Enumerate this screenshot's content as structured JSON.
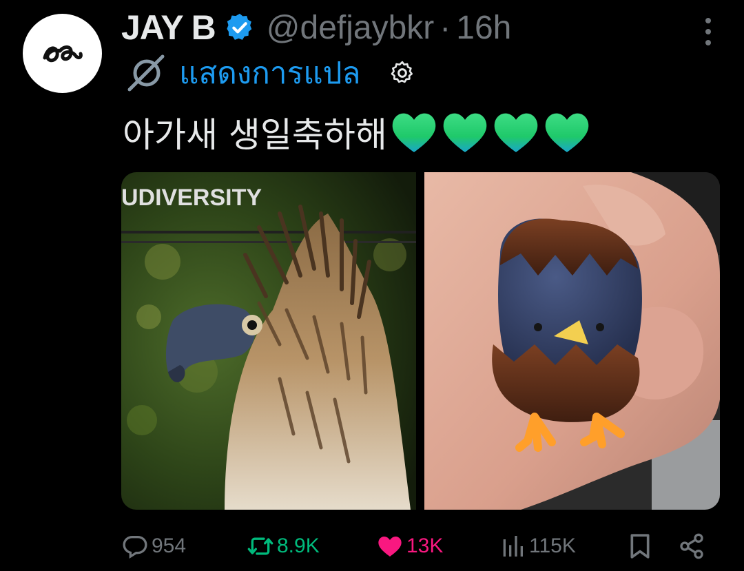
{
  "author": {
    "display_name": "JAY B",
    "handle": "@defjaybkr",
    "separator": "·",
    "time": "16h",
    "avatar_icon": "signature-logo-icon",
    "verified_icon": "verified-badge-icon"
  },
  "translate": {
    "label": "แสดงการแปล",
    "icon": "translate-icon",
    "settings_icon": "gear-icon"
  },
  "tweet": {
    "text": "아가새 생일축하해",
    "emoji": [
      "green-heart",
      "green-heart",
      "green-heart",
      "green-heart"
    ]
  },
  "media": {
    "left_photo_text": "UDIVERSITY",
    "left_photo": "eagle-photo",
    "right_photo": "chick-in-egg-toy-photo"
  },
  "actions": {
    "replies": "954",
    "retweets": "8.9K",
    "likes": "13K",
    "views": "115K"
  },
  "colors": {
    "background": "#000000",
    "primary_text": "#e7e9ea",
    "secondary_text": "#71767b",
    "link": "#1d9bf0",
    "retweet_active": "#00ba7c",
    "like_active": "#f91880"
  }
}
